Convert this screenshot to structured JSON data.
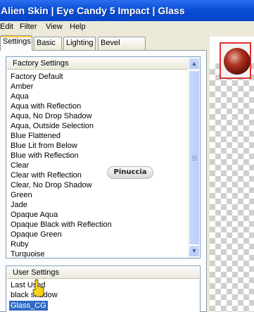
{
  "window": {
    "title": "Alien Skin  |  Eye Candy 5 Impact  |  Glass"
  },
  "menu": [
    "Edit",
    "Filter",
    "View",
    "Help"
  ],
  "tabs": [
    {
      "label": "Settings",
      "active": true
    },
    {
      "label": "Basic",
      "active": false
    },
    {
      "label": "Lighting",
      "active": false
    },
    {
      "label": "Bevel Profile",
      "active": false
    }
  ],
  "factory_settings": {
    "header": "Factory Settings",
    "items": [
      "Factory Default",
      "Amber",
      "Aqua",
      "Aqua with Reflection",
      "Aqua, No Drop Shadow",
      "Aqua, Outside Selection",
      "Blue Flattened",
      "Blue Lit from Below",
      "Blue with Reflection",
      "Clear",
      "Clear with Reflection",
      "Clear, No Drop Shadow",
      "Green",
      "Jade",
      "Opaque Aqua",
      "Opaque Black with Reflection",
      "Opaque Green",
      "Ruby",
      "Turquoise"
    ]
  },
  "user_settings": {
    "header": "User Settings",
    "items": [
      "Last Used",
      "black shadow",
      "Glass_CG"
    ],
    "selected": "Glass_CG"
  },
  "watermark": "Pinuccia",
  "icons": {
    "scroll_up": "scroll-up-arrow-icon",
    "scroll_down": "scroll-down-arrow-icon",
    "cursor": "hand-pointer-icon"
  },
  "colors": {
    "title_bar": "#0a4fd8",
    "selection": "#316ac5",
    "tab_highlight": "#ffc73c",
    "preview_border": "#e03030"
  }
}
